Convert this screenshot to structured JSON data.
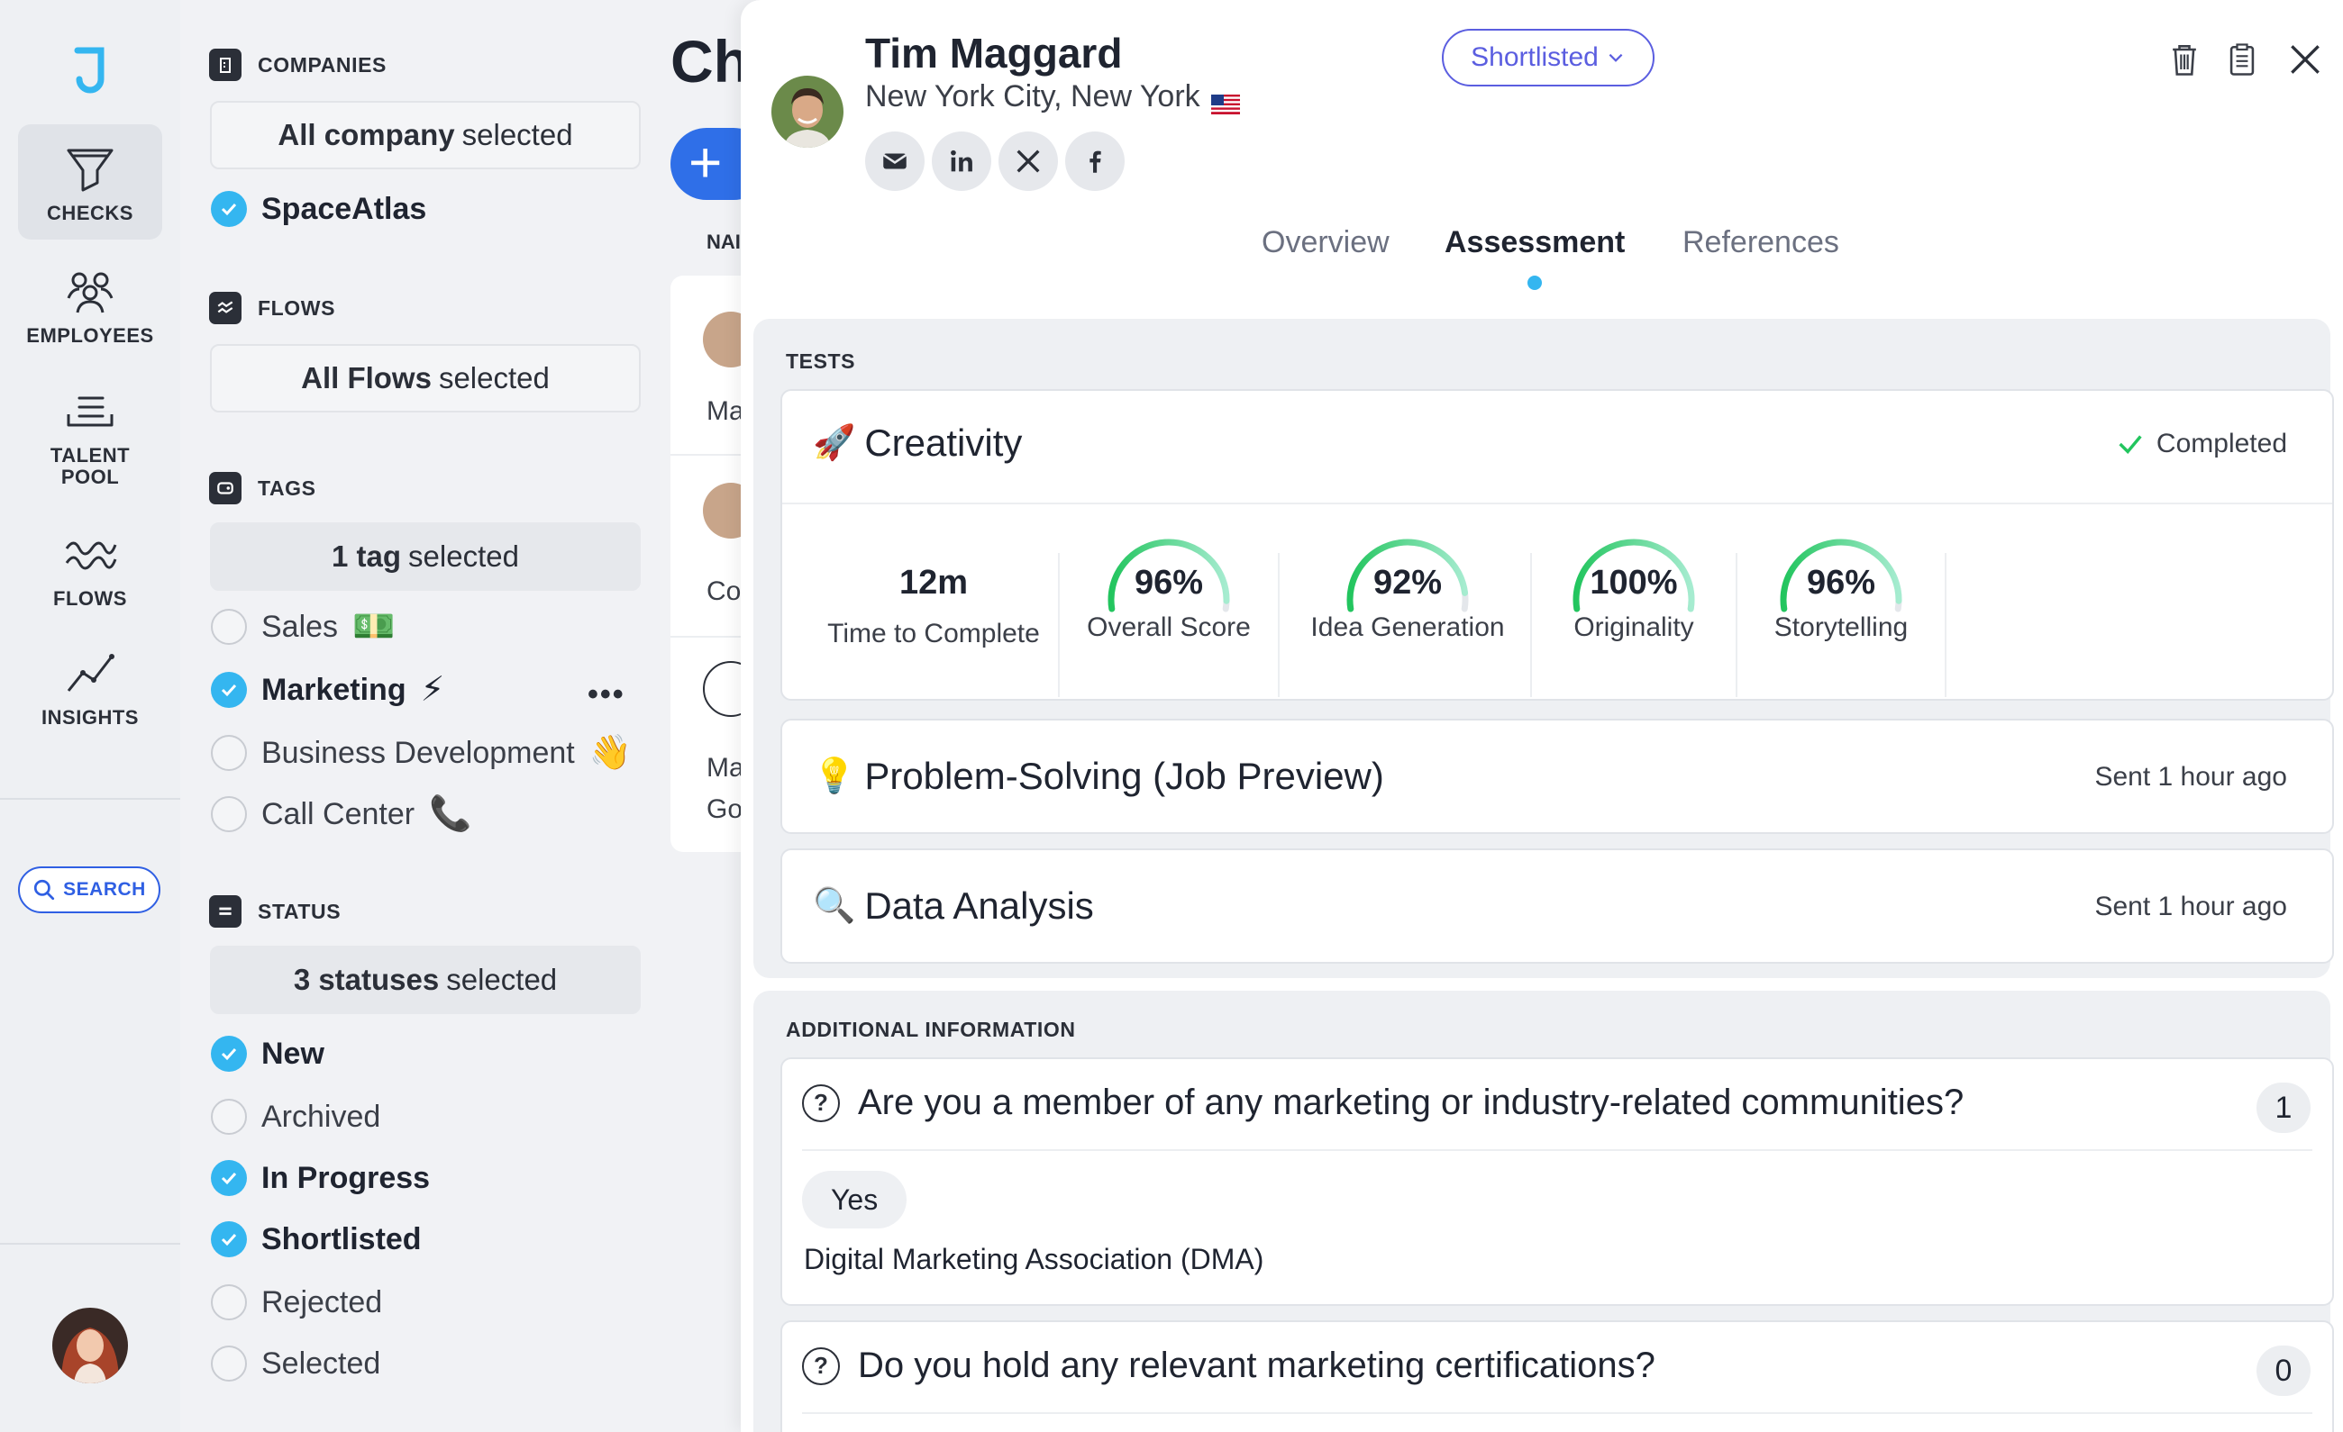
{
  "nav": {
    "items": [
      {
        "label": "CHECKS",
        "icon": "funnel-icon",
        "active": true
      },
      {
        "label": "EMPLOYEES",
        "icon": "people-icon",
        "active": false
      },
      {
        "label": "TALENT\nPOOL",
        "icon": "pool-icon",
        "active": false
      },
      {
        "label": "FLOWS",
        "icon": "waves-icon",
        "active": false
      },
      {
        "label": "INSIGHTS",
        "icon": "chart-line-icon",
        "active": false
      }
    ],
    "search_label": "SEARCH"
  },
  "filters": {
    "companies": {
      "heading": "COMPANIES",
      "selector_bold": "All company",
      "selector_rest": "selected",
      "items": [
        {
          "label": "SpaceAtlas",
          "checked": true
        }
      ]
    },
    "flows": {
      "heading": "FLOWS",
      "selector_bold": "All Flows",
      "selector_rest": "selected"
    },
    "tags": {
      "heading": "TAGS",
      "selector_bold": "1 tag",
      "selector_rest": "selected",
      "items": [
        {
          "label": "Sales",
          "emoji": "💵",
          "checked": false
        },
        {
          "label": "Marketing",
          "emoji": "⚡",
          "checked": true
        },
        {
          "label": "Business Development",
          "emoji": "👋",
          "checked": false
        },
        {
          "label": "Call Center",
          "emoji": "📞",
          "checked": false
        }
      ]
    },
    "status": {
      "heading": "STATUS",
      "selector_bold": "3 statuses",
      "selector_rest": "selected",
      "items": [
        {
          "label": "New",
          "checked": true
        },
        {
          "label": "Archived",
          "checked": false
        },
        {
          "label": "In Progress",
          "checked": true
        },
        {
          "label": "Shortlisted",
          "checked": true
        },
        {
          "label": "Rejected",
          "checked": false
        },
        {
          "label": "Selected",
          "checked": false
        }
      ]
    }
  },
  "underlying": {
    "title": "Ch",
    "plus": "+",
    "column": "NAI",
    "rows": [
      "Ma",
      "Co",
      "Ma",
      "Go"
    ]
  },
  "candidate": {
    "name": "Tim Maggard",
    "location": "New York City, New York",
    "status": "Shortlisted",
    "socials": [
      "mail-icon",
      "linkedin-icon",
      "x-icon",
      "facebook-icon"
    ]
  },
  "tabs": [
    {
      "label": "Overview",
      "active": false
    },
    {
      "label": "Assessment",
      "active": true
    },
    {
      "label": "References",
      "active": false
    }
  ],
  "tests": {
    "heading": "TESTS",
    "items": [
      {
        "emoji": "🚀",
        "name": "Creativity",
        "status": "Completed",
        "time_value": "12m",
        "time_label": "Time to Complete",
        "scores": [
          {
            "value": "96%",
            "fraction": 0.96,
            "label": "Overall Score"
          },
          {
            "value": "92%",
            "fraction": 0.92,
            "label": "Idea Generation"
          },
          {
            "value": "100%",
            "fraction": 1.0,
            "label": "Originality"
          },
          {
            "value": "96%",
            "fraction": 0.96,
            "label": "Storytelling"
          }
        ]
      },
      {
        "emoji": "💡",
        "name": "Problem-Solving (Job Preview)",
        "status": "Sent 1 hour ago"
      },
      {
        "emoji": "🔍",
        "name": "Data Analysis",
        "status": "Sent 1 hour ago"
      }
    ]
  },
  "additional": {
    "heading": "ADDITIONAL INFORMATION",
    "questions": [
      {
        "question": "Are you a member of any marketing or industry-related communities?",
        "count": "1",
        "chip": "Yes",
        "answer": "Digital Marketing Association (DMA)"
      },
      {
        "question": "Do you hold any relevant marketing certifications?",
        "count": "0"
      }
    ]
  },
  "colors": {
    "accent": "#34b6f0",
    "brand_blue": "#2f6fe8",
    "status_purple": "#5b5ee0",
    "gauge_start": "#a6ecd0",
    "gauge_end": "#22c55e"
  }
}
